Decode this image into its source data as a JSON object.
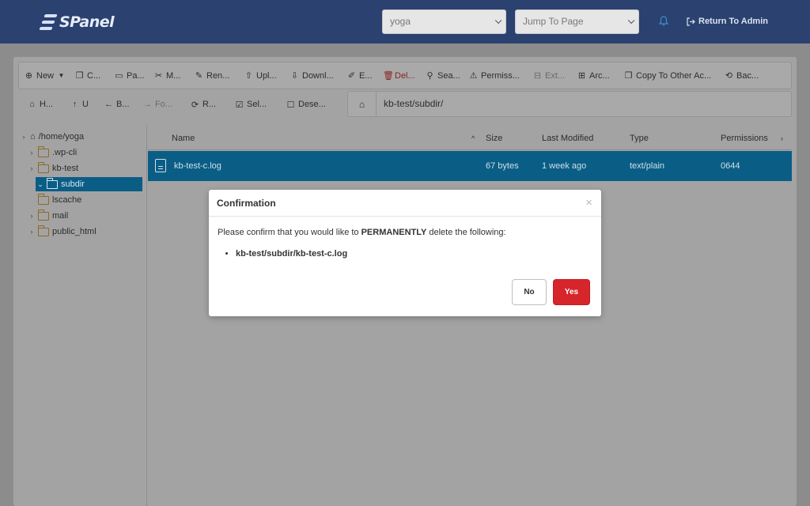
{
  "header": {
    "logo_text": "SPanel",
    "account_select": "yoga",
    "jump_select": "Jump To Page",
    "return_admin": "Return To Admin"
  },
  "toolbar": {
    "items": [
      {
        "label": "New",
        "icon": "plus-circle-icon"
      },
      {
        "label": "C...",
        "icon": "copy-icon"
      },
      {
        "label": "Pa...",
        "icon": "paste-icon"
      },
      {
        "label": "M...",
        "icon": "scissors-icon"
      },
      {
        "label": "Ren...",
        "icon": "rename-icon"
      },
      {
        "label": "Upl...",
        "icon": "upload-icon"
      },
      {
        "label": "Downl...",
        "icon": "download-icon"
      },
      {
        "label": "E...",
        "icon": "edit-icon"
      },
      {
        "label": "Del...",
        "icon": "trash-icon"
      },
      {
        "label": "Sea...",
        "icon": "search-icon"
      },
      {
        "label": "Permiss...",
        "icon": "warning-icon"
      },
      {
        "label": "Ext...",
        "icon": "extract-icon"
      },
      {
        "label": "Arc...",
        "icon": "archive-icon"
      },
      {
        "label": "Copy To Other Ac...",
        "icon": "copy-icon"
      },
      {
        "label": "Bac...",
        "icon": "backup-icon"
      }
    ]
  },
  "toolbar2": {
    "items": [
      {
        "label": "H...",
        "icon": "home-icon"
      },
      {
        "label": "U",
        "icon": "arrow-up-icon"
      },
      {
        "label": "B...",
        "icon": "arrow-left-icon"
      },
      {
        "label": "Fo...",
        "icon": "arrow-right-icon"
      },
      {
        "label": "R...",
        "icon": "reload-icon"
      },
      {
        "label": "Sel...",
        "icon": "checkbox-checked-icon"
      },
      {
        "label": "Dese...",
        "icon": "checkbox-empty-icon"
      }
    ],
    "path": "kb-test/subdir/"
  },
  "tree": {
    "root": "/home/yoga",
    "items": [
      {
        "label": ".wp-cli"
      },
      {
        "label": "kb-test"
      },
      {
        "label": "subdir"
      },
      {
        "label": "lscache"
      },
      {
        "label": "mail"
      },
      {
        "label": "public_html"
      }
    ]
  },
  "table": {
    "columns": [
      "Name",
      "Size",
      "Last Modified",
      "Type",
      "Permissions"
    ],
    "rows": [
      {
        "name": "kb-test-c.log",
        "size": "67 bytes",
        "modified": "1 week ago",
        "type": "text/plain",
        "permissions": "0644"
      }
    ]
  },
  "modal": {
    "title": "Confirmation",
    "close": "×",
    "message_pre": "Please confirm that you would like to ",
    "message_bold": "PERMANENTLY",
    "message_post": " delete the following:",
    "items": [
      "kb-test/subdir/kb-test-c.log"
    ],
    "no_label": "No",
    "yes_label": "Yes"
  },
  "colors": {
    "header_bg": "#2b4170",
    "selection": "#0a5e86",
    "danger": "#d6262b"
  }
}
